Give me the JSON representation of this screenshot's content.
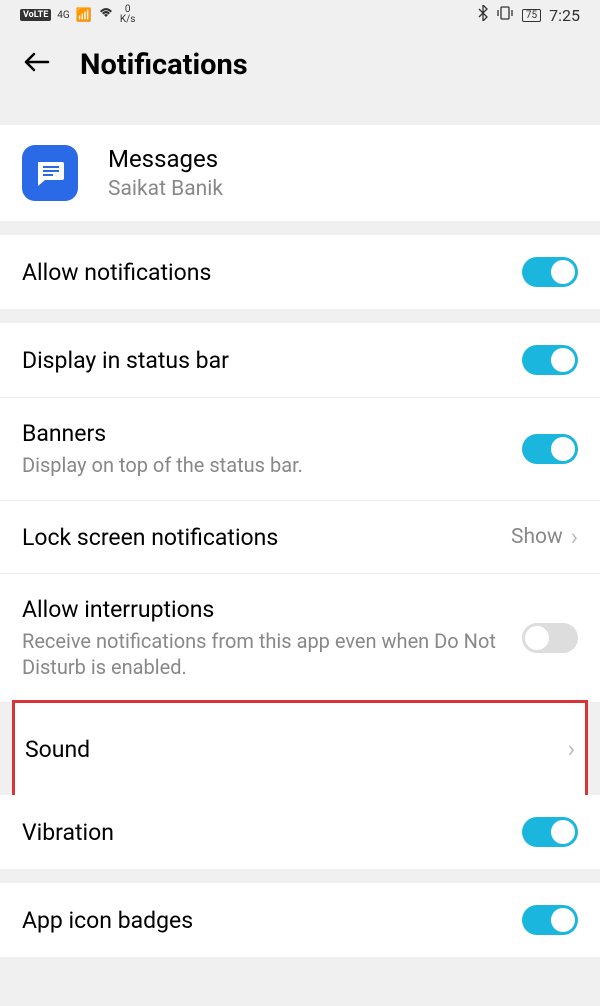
{
  "statusBar": {
    "volte": "VoLTE",
    "network": "4G",
    "speed": "0",
    "speedUnit": "K/s",
    "battery": "75",
    "time": "7:25"
  },
  "header": {
    "title": "Notifications"
  },
  "app": {
    "name": "Messages",
    "owner": "Saikat Banik"
  },
  "settings": {
    "allowNotifications": {
      "label": "Allow notifications",
      "enabled": true
    },
    "displayStatusBar": {
      "label": "Display in status bar",
      "enabled": true
    },
    "banners": {
      "label": "Banners",
      "sublabel": "Display on top of the status bar.",
      "enabled": true
    },
    "lockScreen": {
      "label": "Lock screen notifications",
      "value": "Show"
    },
    "allowInterruptions": {
      "label": "Allow interruptions",
      "sublabel": "Receive notifications from this app even when Do Not Disturb is enabled.",
      "enabled": false
    },
    "sound": {
      "label": "Sound"
    },
    "vibration": {
      "label": "Vibration",
      "enabled": true
    },
    "appIconBadges": {
      "label": "App icon badges",
      "enabled": true
    }
  }
}
